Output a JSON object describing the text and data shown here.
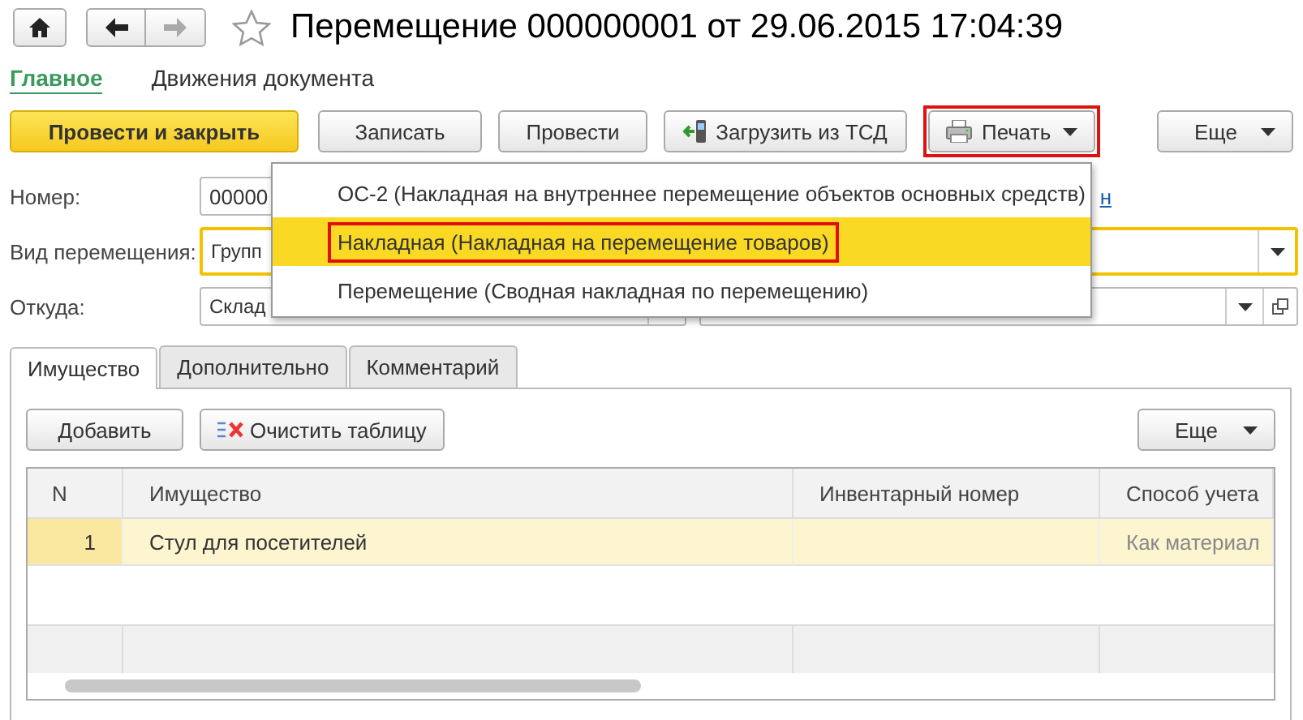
{
  "header": {
    "title": "Перемещение 000000001 от 29.06.2015 17:04:39"
  },
  "sections": [
    {
      "label": "Главное",
      "selected": true
    },
    {
      "label": "Движения документа",
      "selected": false
    }
  ],
  "commands": [
    {
      "label": "Провести и закрыть",
      "kind": "default"
    },
    {
      "label": "Записать",
      "kind": "plain"
    },
    {
      "label": "Провести",
      "kind": "plain"
    },
    {
      "label": "Загрузить из ТСД",
      "kind": "scanner"
    },
    {
      "label": "Печать",
      "kind": "print"
    },
    {
      "label": "Еще",
      "kind": "more"
    }
  ],
  "form": {
    "number_label": "Номер:",
    "number_value": "00000",
    "link_fragment": "н",
    "type_label": "Вид перемещения:",
    "type_value": "Групп",
    "from_label": "Откуда:",
    "from_value": "Склад"
  },
  "print_menu": [
    {
      "label": "ОС-2 (Накладная на внутреннее перемещение объектов основных средств)",
      "selected": false
    },
    {
      "label": "Накладная (Накладная на перемещение товаров)",
      "selected": true
    },
    {
      "label": "Перемещение (Сводная накладная по перемещению)",
      "selected": false
    }
  ],
  "tabs": [
    {
      "label": "Имущество",
      "selected": true
    },
    {
      "label": "Дополнительно",
      "selected": false
    },
    {
      "label": "Комментарий",
      "selected": false
    }
  ],
  "table_toolbar": {
    "add": "Добавить",
    "clear": "Очистить таблицу",
    "more": "Еще"
  },
  "table": {
    "columns": [
      "N",
      "Имущество",
      "Инвентарный номер",
      "Способ учета"
    ],
    "rows": [
      {
        "cells": [
          "1",
          "Стул для посетителей",
          "",
          "Как материал"
        ],
        "selected": true
      }
    ]
  }
}
